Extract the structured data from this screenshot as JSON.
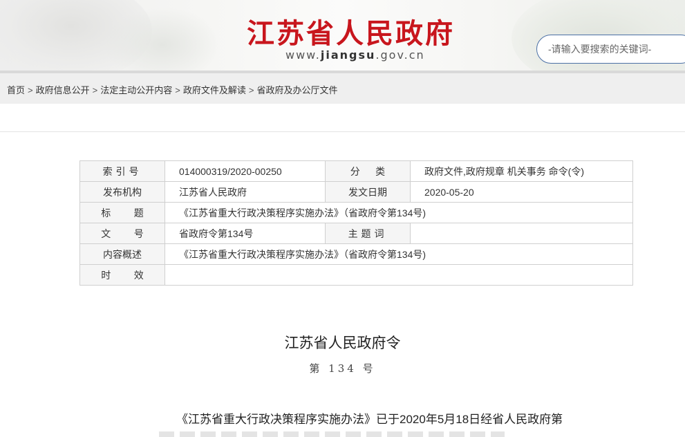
{
  "header": {
    "site_title": "江苏省人民政府",
    "url_prefix": "www.",
    "url_domain": "jiangsu",
    "url_suffix": ".gov.cn",
    "search_placeholder": "-请输入要搜索的关键词-"
  },
  "breadcrumb": [
    "首页",
    "政府信息公开",
    "法定主动公开内容",
    "政府文件及解读",
    "省政府及办公厅文件"
  ],
  "breadcrumb_separator": ">",
  "meta_table": {
    "index_label": "索引号",
    "index_value": "014000319/2020-00250",
    "category_label": "分类",
    "category_value": "政府文件,政府规章 机关事务 命令(令)",
    "publisher_label": "发布机构",
    "publisher_value": "江苏省人民政府",
    "date_label": "发文日期",
    "date_value": "2020-05-20",
    "title_label": "标题",
    "title_value": "《江苏省重大行政决策程序实施办法》（省政府令第134号)",
    "docno_label": "文号",
    "docno_value": "省政府令第134号",
    "keywords_label": "主题词",
    "keywords_value": "",
    "summary_label": "内容概述",
    "summary_value": "《江苏省重大行政决策程序实施办法》（省政府令第134号)",
    "validity_label": "时效",
    "validity_value": ""
  },
  "document": {
    "title": "江苏省人民政府令",
    "number": "第 134 号",
    "body_first_line": "《江苏省重大行政决策程序实施办法》已于2020年5月18日经省人民政府第"
  },
  "colors": {
    "brand_red": "#c8161d",
    "search_border": "#4a6fa5",
    "breadcrumb_bg": "#efefef",
    "label_cell_bg": "#f5f5f5"
  }
}
